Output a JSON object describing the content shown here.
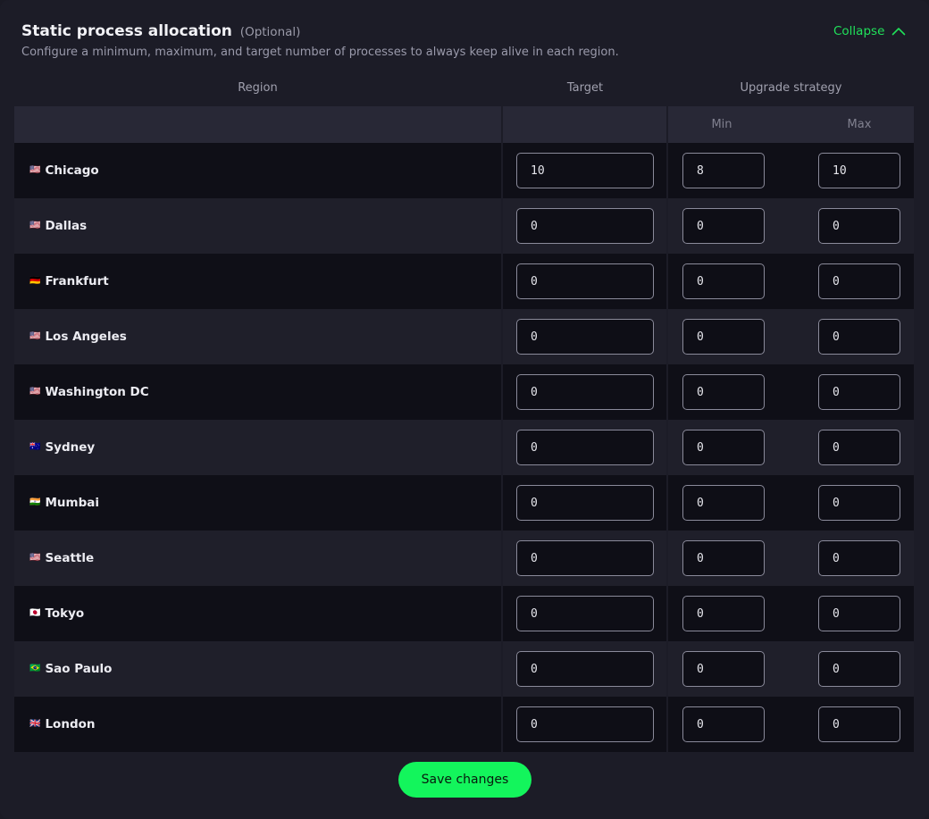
{
  "header": {
    "title": "Static process allocation",
    "optional": "(Optional)",
    "subtitle": "Configure a minimum, maximum, and target number of processes to always keep alive in each region.",
    "collapse_label": "Collapse"
  },
  "columns": {
    "region": "Region",
    "target": "Target",
    "upgrade_strategy": "Upgrade strategy",
    "min": "Min",
    "max": "Max"
  },
  "rows": [
    {
      "flag": "🇺🇸",
      "region": "Chicago",
      "target": "10",
      "min": "8",
      "max": "10"
    },
    {
      "flag": "🇺🇸",
      "region": "Dallas",
      "target": "0",
      "min": "0",
      "max": "0"
    },
    {
      "flag": "🇩🇪",
      "region": "Frankfurt",
      "target": "0",
      "min": "0",
      "max": "0"
    },
    {
      "flag": "🇺🇸",
      "region": "Los Angeles",
      "target": "0",
      "min": "0",
      "max": "0"
    },
    {
      "flag": "🇺🇸",
      "region": "Washington DC",
      "target": "0",
      "min": "0",
      "max": "0"
    },
    {
      "flag": "🇦🇺",
      "region": "Sydney",
      "target": "0",
      "min": "0",
      "max": "0"
    },
    {
      "flag": "🇮🇳",
      "region": "Mumbai",
      "target": "0",
      "min": "0",
      "max": "0"
    },
    {
      "flag": "🇺🇸",
      "region": "Seattle",
      "target": "0",
      "min": "0",
      "max": "0"
    },
    {
      "flag": "🇯🇵",
      "region": "Tokyo",
      "target": "0",
      "min": "0",
      "max": "0"
    },
    {
      "flag": "🇧🇷",
      "region": "Sao Paulo",
      "target": "0",
      "min": "0",
      "max": "0"
    },
    {
      "flag": "🇬🇧",
      "region": "London",
      "target": "0",
      "min": "0",
      "max": "0"
    }
  ],
  "footer": {
    "save_label": "Save changes"
  },
  "colors": {
    "accent": "#13f55c",
    "link": "#20e05a",
    "background": "#1c1c27"
  },
  "icons": {
    "collapse": "chevron-up-icon"
  }
}
